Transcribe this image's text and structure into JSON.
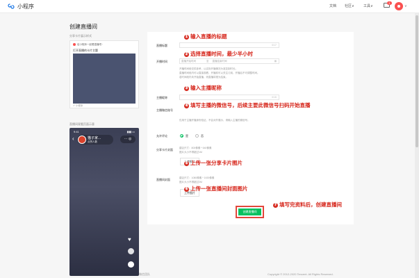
{
  "header": {
    "brand": "小程序",
    "nav": [
      "文档",
      "社区",
      "工具"
    ],
    "nav_caret": "∨",
    "mail_badge": "1"
  },
  "page": {
    "title": "创建直播间"
  },
  "left": {
    "share_label": "分享卡片展示样式",
    "share_card": {
      "head": "给小程序一起看直播吧~",
      "title": "打开直播的卡片主题",
      "foot": "小程序"
    },
    "player_label": "直播间观看页面示意",
    "phone": {
      "time": "9:41",
      "status": "▮▮▮ ▭",
      "back": "‹",
      "name": "猫子家...",
      "sub": "点赞人数",
      "follow": "直...",
      "ctrl": "··· ◎",
      "heart": "♥"
    }
  },
  "form": {
    "title_label": "直播标题",
    "title_count": "0/17",
    "time_label": "开播时间",
    "time_start_placeholder": "直播开始时间",
    "time_sep": "至",
    "time_end_placeholder": "直播结束时间",
    "time_hint_1": "开播时间段仅供参考，以实际开播情况为准控制时长。",
    "time_hint_2": "直播时间段内可以直接观看，开播前可以关注订阅，开播后不可调整时间。",
    "time_hint_3": "若时间段内未开始直播，则直播将视为结束。",
    "anchor_name_label": "主播昵称",
    "anchor_name_count": "0/15",
    "anchor_wechat_label": "主播微信账号",
    "anchor_wechat_hint": "仅用于主播开播身份验证，不会对外展示，请输入主播的微信号。",
    "comment_label": "允许评论",
    "comment_yes": "是",
    "comment_no": "否",
    "share_img_label": "分享卡片封面",
    "share_img_hint_1": "建议尺寸：800像素 * 640像素",
    "share_img_hint_2": "图片大小不得超过1M",
    "upload_label": "上传图片",
    "cover_label": "直播间封面",
    "cover_hint_1": "建议尺寸：1080像素 * 1920像素",
    "cover_hint_2": "图片大小不得超过2M",
    "submit_label": "创建直播间"
  },
  "annotations": [
    {
      "n": "1",
      "text": "输入直播的标题"
    },
    {
      "n": "2",
      "text": "选择直播时间，最少半小时"
    },
    {
      "n": "3",
      "text": "输入主播昵称"
    },
    {
      "n": "4",
      "text": "填写主播的微信号，后续主要此微信号扫码开始直播"
    },
    {
      "n": "5",
      "text": "上传一张分享卡片图片"
    },
    {
      "n": "6",
      "text": "上传一张直播间封面图片"
    },
    {
      "n": "7",
      "text": "填写完资料后，创建直播间"
    }
  ],
  "footer": {
    "left": "微信团队",
    "right": "Copyright © 2012-2020 Tencent. All Rights Reserved."
  },
  "colors": {
    "accent": "#07c160",
    "annotation": "#d6261b",
    "badge": "#fa5151"
  }
}
